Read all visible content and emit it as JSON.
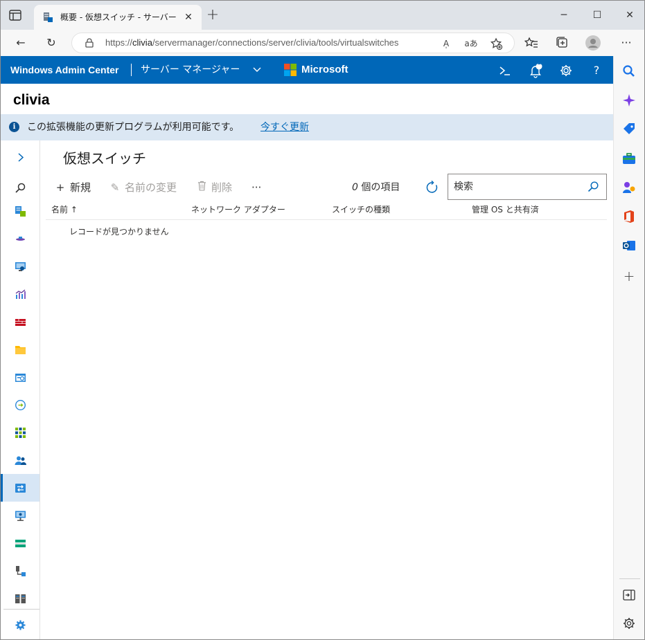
{
  "browser": {
    "tab_title": "概要 - 仮想スイッチ - サーバー マネージャー",
    "url_prefix": "https://",
    "url_host": "clivia",
    "url_path": "/servermanager/connections/server/clivia/tools/virtualswitches",
    "read_aloud": "A̩",
    "translate": "aあ"
  },
  "wac": {
    "title": "Windows Admin Center",
    "app": "サーバー マネージャー",
    "brand": "Microsoft",
    "notification_count": "1",
    "help": "?"
  },
  "server": {
    "name": "clivia"
  },
  "infobar": {
    "message": "この拡張機能の更新プログラムが利用可能です。",
    "link": "今すぐ更新"
  },
  "page": {
    "title": "仮想スイッチ",
    "commands": {
      "new": "新規",
      "rename": "名前の変更",
      "delete": "削除",
      "more": "···"
    },
    "item_count_num": "0",
    "item_count_label": " 個の項目",
    "search_placeholder": "検索",
    "columns": [
      "名前 ↑",
      "ネットワーク アダプター",
      "スイッチの種類",
      "管理 OS と共有済"
    ],
    "empty_message": "レコードが見つかりません"
  },
  "colors": {
    "accent": "#0067b8",
    "infobar_bg": "#dbe7f3",
    "active_nav_bg": "#d7e6f5"
  },
  "nav_icons": [
    "expand-chevron-icon",
    "search-icon",
    "overview-icon",
    "network-icon",
    "remote-desktop-icon",
    "performance-icon",
    "firewall-icon",
    "files-icon",
    "events-icon",
    "connections-icon",
    "apps-icon",
    "users-icon",
    "virtual-switch-icon",
    "virtual-machines-icon",
    "storage-icon",
    "devices-icon",
    "servers-icon",
    "settings-icon"
  ]
}
